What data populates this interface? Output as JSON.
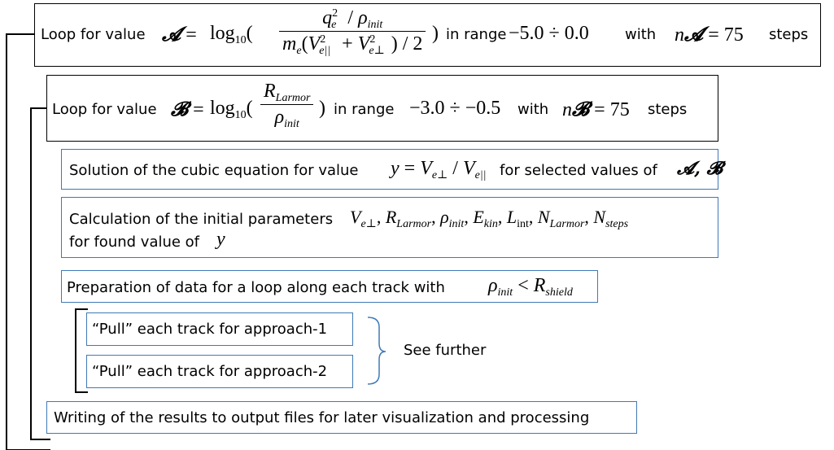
{
  "loopA": {
    "prefix": "Loop for value",
    "symbol": "𝓐",
    "log": "log",
    "log_base": "10",
    "num_q": "q",
    "num_q_sub": "e",
    "num_exp": "2",
    "num_slash": "/",
    "num_rho": "ρ",
    "num_rho_sub": "init",
    "den_m": "m",
    "den_m_sub": "e",
    "den_v1": "V",
    "den_v1_sub": "e||",
    "den_v1_exp": "2",
    "den_plus": "+",
    "den_v2": "V",
    "den_v2_sub": "e⊥",
    "den_v2_exp": "2",
    "den_tail": ") / 2",
    "range_label": "in range",
    "range": "−5.0 ÷ 0.0",
    "with_label": "with",
    "n": "n",
    "n_value": "= 75",
    "steps_label": "steps"
  },
  "loopB": {
    "prefix": "Loop for value",
    "symbol": "𝓑",
    "log": "log",
    "log_base": "10",
    "num_r": "R",
    "num_r_sub": "Larmor",
    "den_rho": "ρ",
    "den_rho_sub": "init",
    "range_label": "in range",
    "range": "−3.0 ÷ −0.5",
    "with_label": "with",
    "n": "n",
    "n_value": "= 75",
    "steps_label": "steps"
  },
  "cubic": {
    "text": "Solution of the cubic equation for value",
    "y": "y",
    "eq": "=",
    "v1": "V",
    "v1_sub": "e⊥",
    "slash": "/",
    "v2": "V",
    "v2_sub": "e||",
    "tail": "for selected values of",
    "symbols": "𝓐, 𝓑"
  },
  "calc": {
    "line1": "Calculation of the initial parameters",
    "params": [
      {
        "base": "V",
        "sub": "e⊥"
      },
      {
        "base": "R",
        "sub": "Larmor"
      },
      {
        "base": "ρ",
        "sub": "init"
      },
      {
        "base": "E",
        "sub": "kin"
      },
      {
        "base": "L",
        "sub": "int"
      },
      {
        "base": "N",
        "sub": "Larmor"
      },
      {
        "base": "N",
        "sub": "steps"
      }
    ],
    "line2": "for found value of",
    "y": "y"
  },
  "prep": {
    "text": "Preparation of data for a loop along each track with",
    "rho": "ρ",
    "rho_sub": "init",
    "lt": "<",
    "r": "R",
    "r_sub": "shield"
  },
  "pull1": "“Pull” each track for approach-1",
  "pull2": "“Pull” each track for approach-2",
  "see_further": "See further",
  "writing": "Writing of the results to output files for later visualization and processing",
  "colors": {
    "box_border": "#3f79b6",
    "outer_border": "#000000"
  }
}
